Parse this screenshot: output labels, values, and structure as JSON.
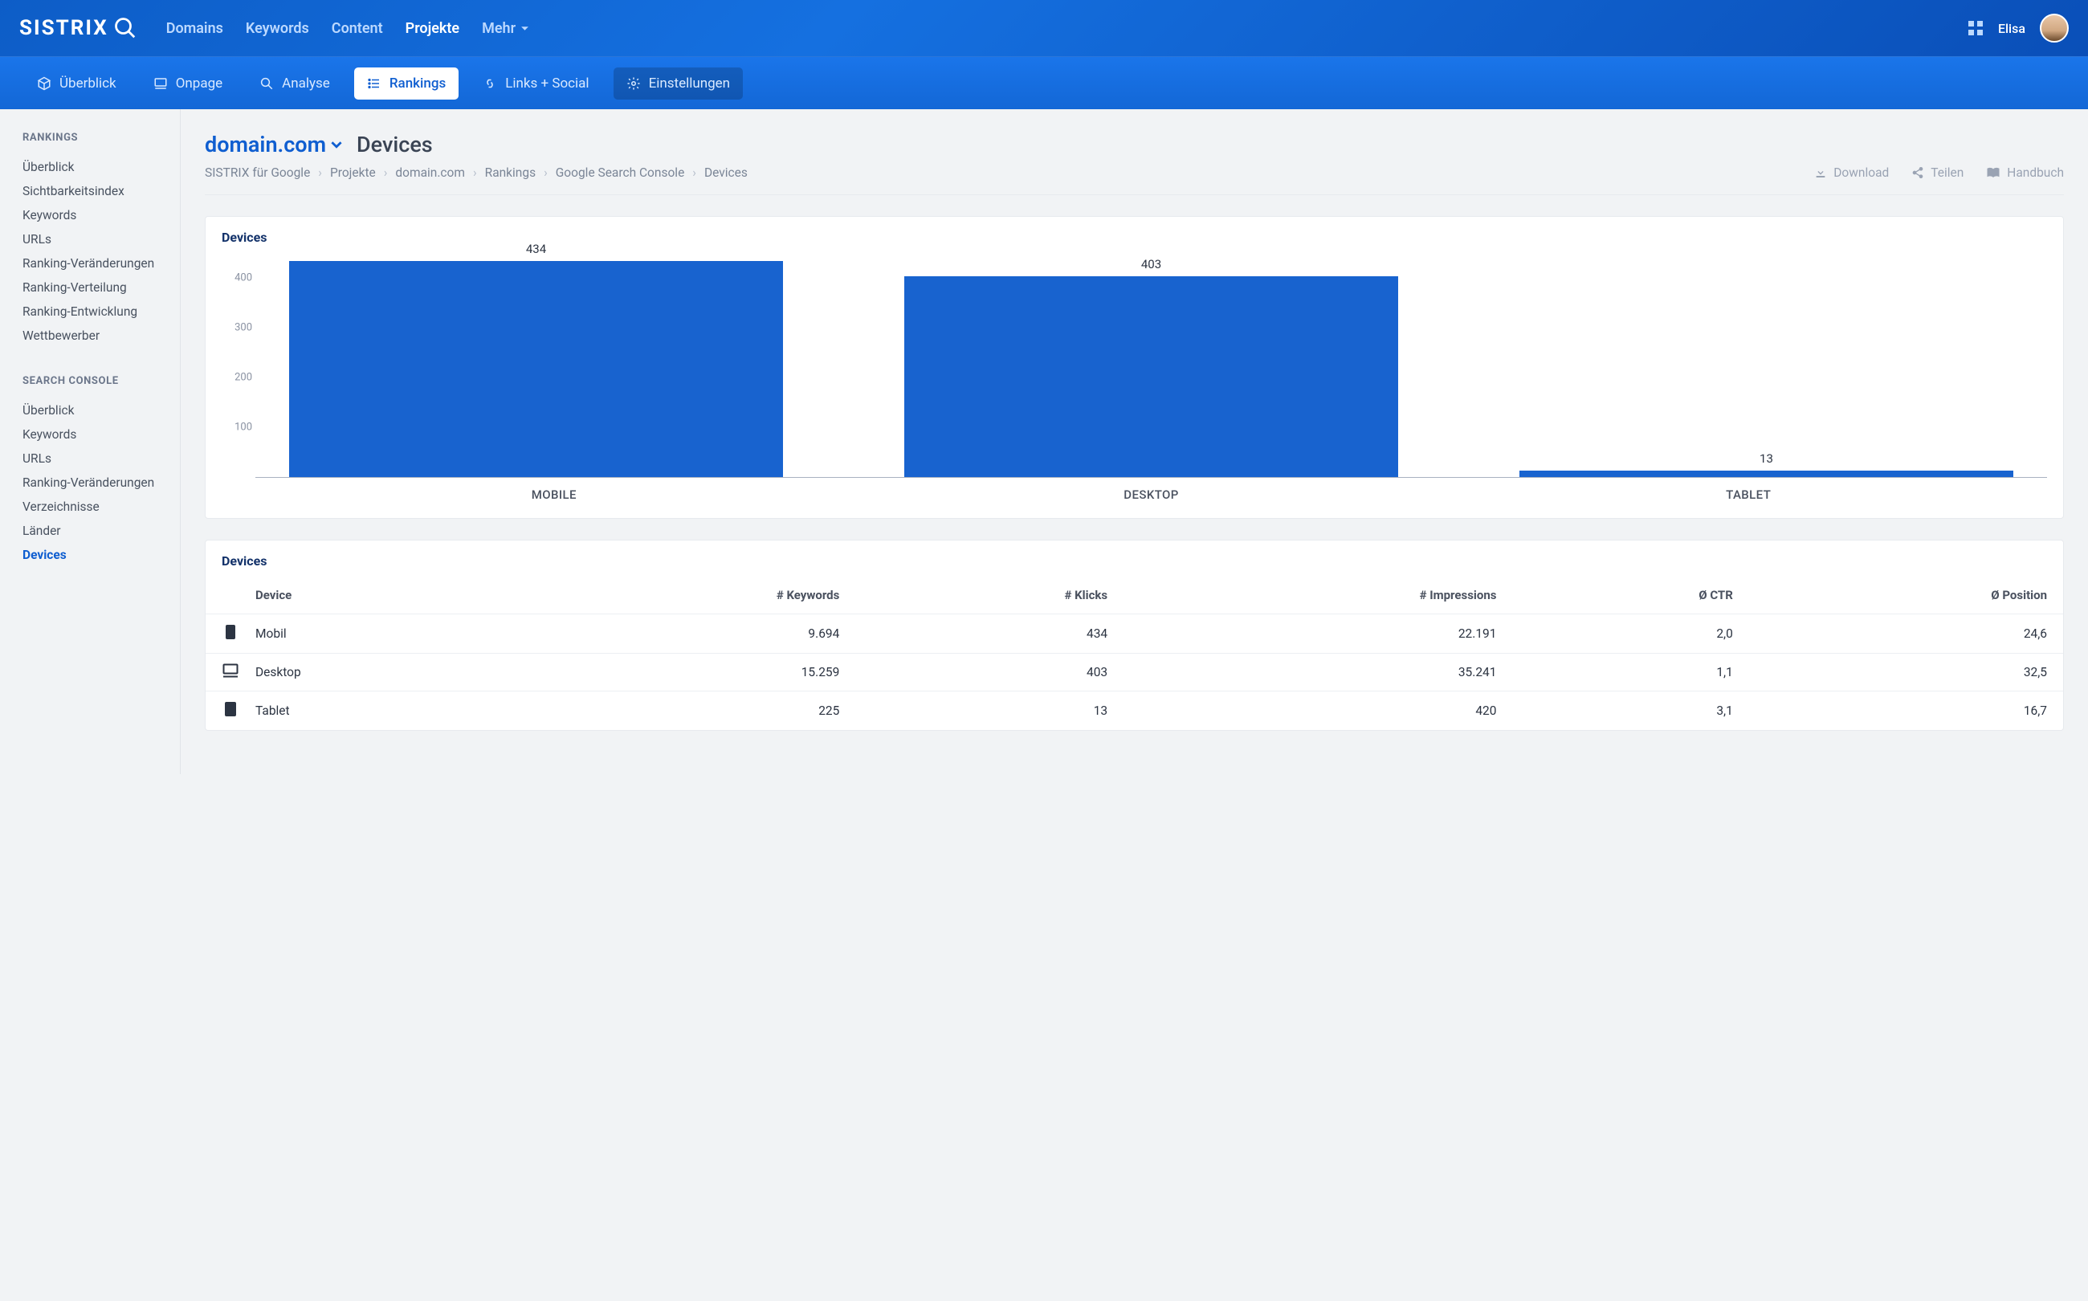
{
  "brand": "SISTRIX",
  "nav": {
    "domains": "Domains",
    "keywords": "Keywords",
    "content": "Content",
    "projekte": "Projekte",
    "mehr": "Mehr"
  },
  "user": {
    "name": "Elisa"
  },
  "subnav": {
    "ueberblick": "Überblick",
    "onpage": "Onpage",
    "analyse": "Analyse",
    "rankings": "Rankings",
    "links_social": "Links + Social",
    "einstellungen": "Einstellungen"
  },
  "sidebar": {
    "rankings": {
      "heading": "RANKINGS",
      "items": [
        "Überblick",
        "Sichtbarkeitsindex",
        "Keywords",
        "URLs",
        "Ranking-Veränderungen",
        "Ranking-Verteilung",
        "Ranking-Entwicklung",
        "Wettbewerber"
      ]
    },
    "search_console": {
      "heading": "SEARCH CONSOLE",
      "items": [
        "Überblick",
        "Keywords",
        "URLs",
        "Ranking-Veränderungen",
        "Verzeichnisse",
        "Länder",
        "Devices"
      ]
    }
  },
  "page": {
    "domain": "domain.com",
    "title": "Devices",
    "breadcrumb": [
      "SISTRIX für Google",
      "Projekte",
      "domain.com",
      "Rankings",
      "Google Search Console",
      "Devices"
    ],
    "actions": {
      "download": "Download",
      "share": "Teilen",
      "handbook": "Handbuch"
    }
  },
  "chart_data": {
    "type": "bar",
    "title": "Devices",
    "categories": [
      "MOBILE",
      "DESKTOP",
      "TABLET"
    ],
    "values": [
      434,
      403,
      13
    ],
    "ylim": [
      0,
      450
    ],
    "yticks": [
      100,
      200,
      300,
      400
    ],
    "xlabel": "",
    "ylabel": ""
  },
  "table": {
    "title": "Devices",
    "headers": {
      "device": "Device",
      "keywords": "# Keywords",
      "klicks": "# Klicks",
      "impressions": "# Impressions",
      "ctr": "Ø CTR",
      "position": "Ø Position"
    },
    "rows": [
      {
        "icon": "mobile",
        "device": "Mobil",
        "keywords": "9.694",
        "klicks": "434",
        "impressions": "22.191",
        "ctr": "2,0",
        "position": "24,6"
      },
      {
        "icon": "desktop",
        "device": "Desktop",
        "keywords": "15.259",
        "klicks": "403",
        "impressions": "35.241",
        "ctr": "1,1",
        "position": "32,5"
      },
      {
        "icon": "tablet",
        "device": "Tablet",
        "keywords": "225",
        "klicks": "13",
        "impressions": "420",
        "ctr": "3,1",
        "position": "16,7"
      }
    ]
  }
}
